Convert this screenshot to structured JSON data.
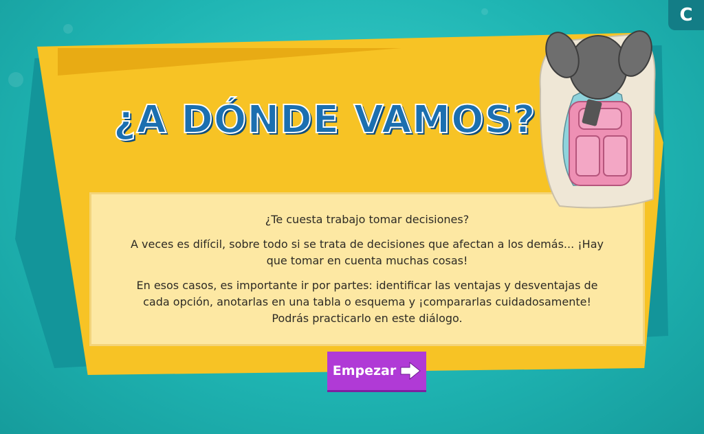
{
  "corner_badge": {
    "label": "C"
  },
  "card": {
    "title": "¿A DÓNDE VAMOS?",
    "paragraphs": [
      "¿Te cuesta trabajo tomar decisiones?",
      "A veces es difícil, sobre todo si se trata de decisiones que afectan a los demás... ¡Hay que tomar en cuenta muchas cosas!",
      "En esos casos, es importante ir por partes: identificar las ventajas y desventajas de cada opción, anotarlas en una tabla o esquema y ¡compararlas cuidadosamente! Podrás practicarlo en este diálogo."
    ]
  },
  "start_button": {
    "label": "Empezar",
    "icon": "arrow-right-icon"
  },
  "illustration": {
    "icon": "girl-with-backpack-icon"
  },
  "colors": {
    "background": "#1fb5b3",
    "card": "#f7c325",
    "panel": "#fde8a3",
    "title": "#1b6fb0",
    "button": "#b03ad6"
  }
}
